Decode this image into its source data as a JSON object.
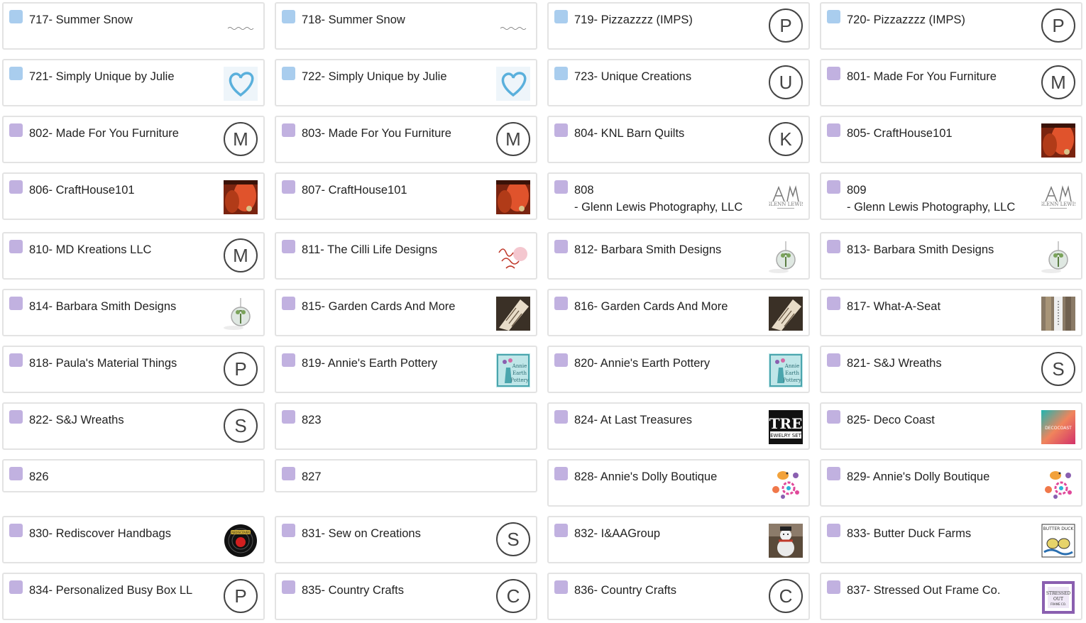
{
  "colors": {
    "swatch_blue": "#a9cdee",
    "swatch_purple": "#c1b1e0",
    "card_border": "#e3e3e3",
    "avatar_stroke": "#444444"
  },
  "cards": [
    {
      "label": "717- Summer Snow",
      "swatch": "blue",
      "thumb": "script-text-logo"
    },
    {
      "label": "718- Summer Snow",
      "swatch": "blue",
      "thumb": "script-text-logo"
    },
    {
      "label": "719- Pizzazzzz (IMPS)",
      "swatch": "blue",
      "letter": "P"
    },
    {
      "label": "720- Pizzazzzz (IMPS)",
      "swatch": "blue",
      "letter": "P"
    },
    {
      "label": "721- Simply Unique by Julie",
      "swatch": "blue",
      "thumb": "heart-logo"
    },
    {
      "label": "722- Simply Unique by Julie",
      "swatch": "blue",
      "thumb": "heart-logo"
    },
    {
      "label": "723- Unique Creations",
      "swatch": "blue",
      "letter": "U"
    },
    {
      "label": "801- Made For You Furniture",
      "swatch": "purple",
      "letter": "M"
    },
    {
      "label": "802- Made For You Furniture",
      "swatch": "purple",
      "letter": "M"
    },
    {
      "label": "803- Made For You Furniture",
      "swatch": "purple",
      "letter": "M"
    },
    {
      "label": "804- KNL Barn Quilts",
      "swatch": "purple",
      "letter": "K"
    },
    {
      "label": "805- CraftHouse101",
      "swatch": "purple",
      "thumb": "red-photo"
    },
    {
      "label": "806- CraftHouse101",
      "swatch": "purple",
      "thumb": "red-photo"
    },
    {
      "label": "807- CraftHouse101",
      "swatch": "purple",
      "thumb": "red-photo"
    },
    {
      "label": "808\n- Glenn Lewis Photography, LLC",
      "swatch": "purple",
      "thumb": "glenn-logo"
    },
    {
      "label": "809\n- Glenn Lewis Photography, LLC",
      "swatch": "purple",
      "thumb": "glenn-logo"
    },
    {
      "label": "810- MD Kreations LLC",
      "swatch": "purple",
      "letter": "M"
    },
    {
      "label": "811- The Cilli Life Designs",
      "swatch": "purple",
      "thumb": "cilli-logo"
    },
    {
      "label": "812- Barbara Smith Designs",
      "swatch": "purple",
      "thumb": "pendant-photo"
    },
    {
      "label": "813- Barbara Smith Designs",
      "swatch": "purple",
      "thumb": "pendant-photo"
    },
    {
      "label": "814- Barbara Smith Designs",
      "swatch": "purple",
      "thumb": "pendant-photo"
    },
    {
      "label": "815- Garden Cards And More",
      "swatch": "purple",
      "thumb": "card-photo"
    },
    {
      "label": "816- Garden Cards And More",
      "swatch": "purple",
      "thumb": "card-photo"
    },
    {
      "label": "817- What-A-Seat",
      "swatch": "purple",
      "thumb": "seat-photo"
    },
    {
      "label": "818- Paula's Material Things",
      "swatch": "purple",
      "letter": "P"
    },
    {
      "label": "819- Annie's Earth Pottery",
      "swatch": "purple",
      "thumb": "pottery-logo"
    },
    {
      "label": "820- Annie's Earth Pottery",
      "swatch": "purple",
      "thumb": "pottery-logo"
    },
    {
      "label": "821- S&J Wreaths",
      "swatch": "purple",
      "letter": "S"
    },
    {
      "label": "822- S&J Wreaths",
      "swatch": "purple",
      "letter": "S"
    },
    {
      "label": "823",
      "swatch": "purple"
    },
    {
      "label": "824- At Last Treasures",
      "swatch": "purple",
      "thumb": "treasures-logo"
    },
    {
      "label": "825- Deco Coast",
      "swatch": "purple",
      "thumb": "deco-logo"
    },
    {
      "label": "826",
      "swatch": "purple"
    },
    {
      "label": "827",
      "swatch": "purple"
    },
    {
      "label": "828- Annie's Dolly Boutique",
      "swatch": "purple",
      "thumb": "flowers-logo"
    },
    {
      "label": "829- Annie's Dolly Boutique",
      "swatch": "purple",
      "thumb": "flowers-logo"
    },
    {
      "label": "830- Rediscover Handbags",
      "swatch": "purple",
      "thumb": "handbags-logo"
    },
    {
      "label": "831- Sew on Creations",
      "swatch": "purple",
      "letter": "S"
    },
    {
      "label": "832- I&AAGroup",
      "swatch": "purple",
      "thumb": "snowman-photo"
    },
    {
      "label": "833- Butter Duck Farms",
      "swatch": "purple",
      "thumb": "duck-logo"
    },
    {
      "label": "834- Personalized Busy Box LL",
      "swatch": "purple",
      "letter": "P"
    },
    {
      "label": "835- Country Crafts",
      "swatch": "purple",
      "letter": "C"
    },
    {
      "label": "836- Country Crafts",
      "swatch": "purple",
      "letter": "C"
    },
    {
      "label": "837- Stressed Out Frame Co.",
      "swatch": "purple",
      "thumb": "frame-logo"
    }
  ]
}
